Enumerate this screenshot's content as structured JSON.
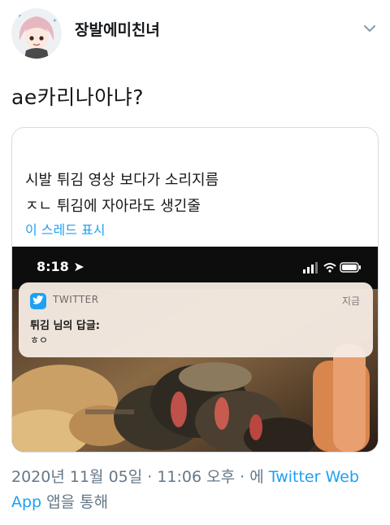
{
  "user": {
    "display_name": "장발에미친녀"
  },
  "tweet": {
    "text": "ae카리나아냐?"
  },
  "quote": {
    "line1": "시발 튀김 영상 보다가 소리지름",
    "line2": "ㅈㄴ 튀김에 자아라도 생긴줄",
    "show_thread": "이 스레드 표시",
    "media": {
      "status_time": "8:18",
      "notification": {
        "app": "TWITTER",
        "time": "지금",
        "title": "튀김 님의 답글:",
        "body": "ㅎㅇ"
      }
    }
  },
  "meta": {
    "date": "2020년 11월 05일 · 11:06 오후 · 에 ",
    "source_link": "Twitter Web App",
    "suffix": " 앱을 통해"
  },
  "colors": {
    "link": "#1da1f2",
    "muted": "#657786",
    "border": "#d7dde2"
  }
}
